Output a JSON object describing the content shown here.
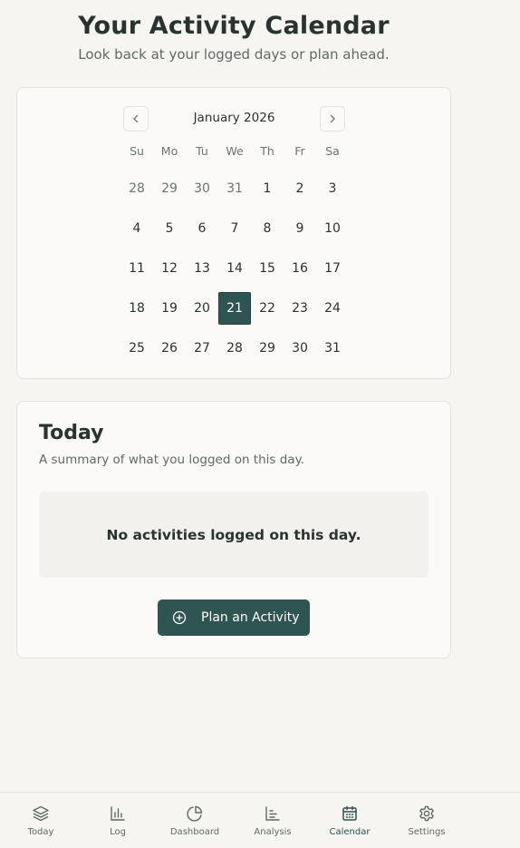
{
  "header": {
    "title": "Your Activity Calendar",
    "subtitle": "Look back at your logged days or plan ahead."
  },
  "calendar": {
    "month_label": "January 2026",
    "prev_icon": "chevron-left-icon",
    "next_icon": "chevron-right-icon",
    "weekdays": [
      "Su",
      "Mo",
      "Tu",
      "We",
      "Th",
      "Fr",
      "Sa"
    ],
    "days": [
      {
        "label": "28",
        "outside": true
      },
      {
        "label": "29",
        "outside": true
      },
      {
        "label": "30",
        "outside": true
      },
      {
        "label": "31",
        "outside": true
      },
      {
        "label": "1"
      },
      {
        "label": "2"
      },
      {
        "label": "3"
      },
      {
        "label": "4"
      },
      {
        "label": "5"
      },
      {
        "label": "6"
      },
      {
        "label": "7"
      },
      {
        "label": "8"
      },
      {
        "label": "9"
      },
      {
        "label": "10"
      },
      {
        "label": "11"
      },
      {
        "label": "12"
      },
      {
        "label": "13"
      },
      {
        "label": "14"
      },
      {
        "label": "15"
      },
      {
        "label": "16"
      },
      {
        "label": "17"
      },
      {
        "label": "18"
      },
      {
        "label": "19"
      },
      {
        "label": "20"
      },
      {
        "label": "21",
        "selected": true
      },
      {
        "label": "22"
      },
      {
        "label": "23"
      },
      {
        "label": "24"
      },
      {
        "label": "25"
      },
      {
        "label": "26"
      },
      {
        "label": "27"
      },
      {
        "label": "28"
      },
      {
        "label": "29"
      },
      {
        "label": "30"
      },
      {
        "label": "31"
      }
    ]
  },
  "today": {
    "title": "Today",
    "subtitle": "A summary of what you logged on this day.",
    "empty_message": "No activities logged on this day.",
    "plan_button_label": "Plan an Activity",
    "plan_button_icon": "plus-circle-icon"
  },
  "bottom_nav": {
    "items": [
      {
        "label": "Today",
        "icon": "layers-icon",
        "active": false
      },
      {
        "label": "Log",
        "icon": "bar-chart-icon",
        "active": false
      },
      {
        "label": "Dashboard",
        "icon": "pie-chart-icon",
        "active": false
      },
      {
        "label": "Analysis",
        "icon": "line-chart-icon",
        "active": false
      },
      {
        "label": "Calendar",
        "icon": "calendar-icon",
        "active": true
      },
      {
        "label": "Settings",
        "icon": "gear-icon",
        "active": false
      }
    ]
  },
  "colors": {
    "accent": "#2e5551",
    "background": "#f6f5f1",
    "card": "#fbfaf8",
    "text": "#2b3330",
    "muted": "#5f6a66"
  }
}
